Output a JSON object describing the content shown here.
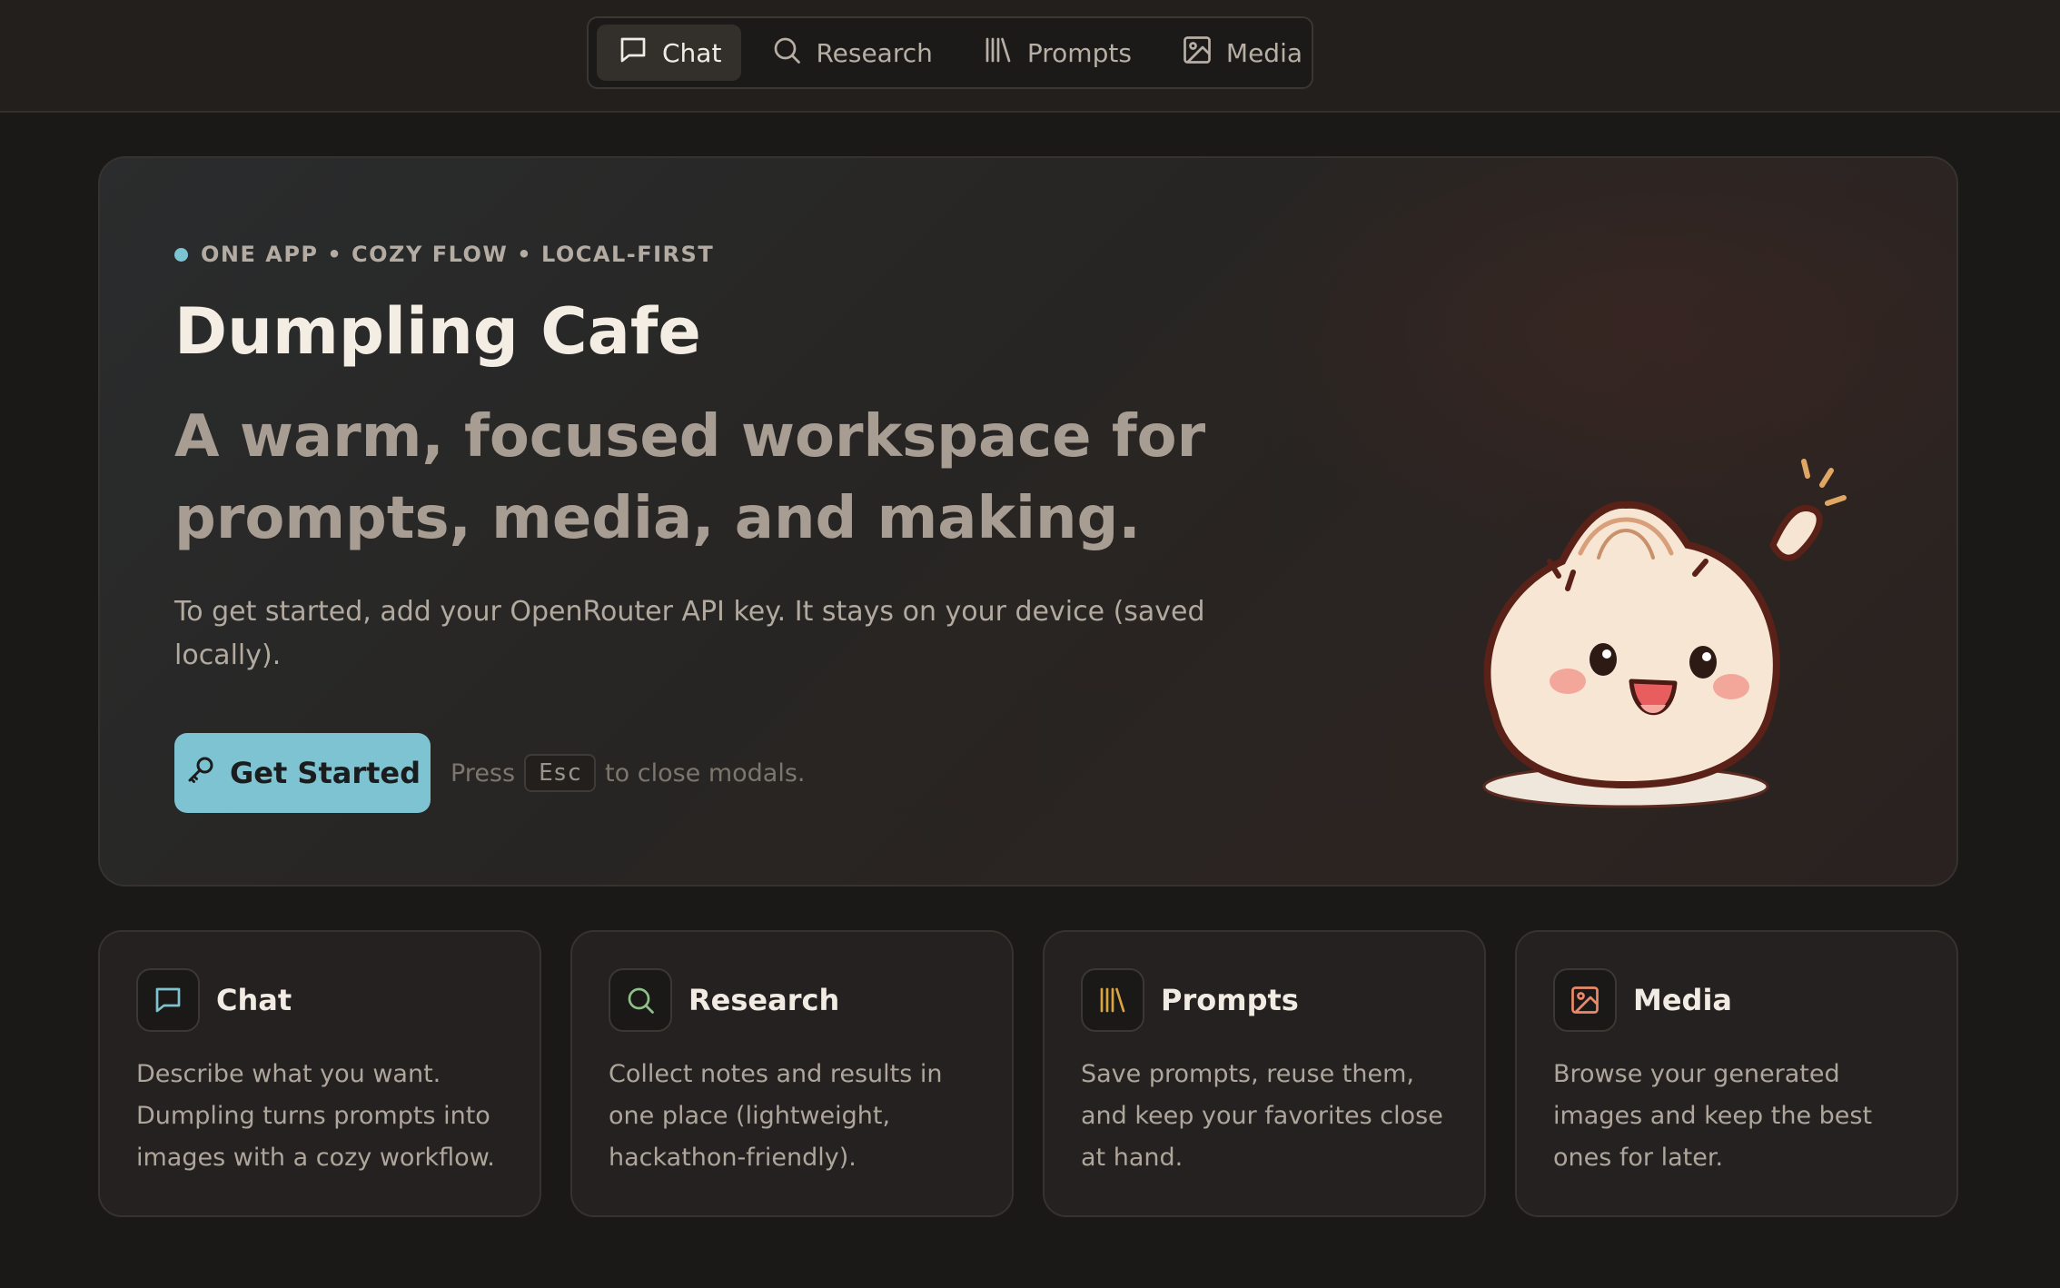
{
  "nav": {
    "items": [
      {
        "label": "Chat",
        "icon": "chat-bubble-icon",
        "active": true
      },
      {
        "label": "Research",
        "icon": "search-icon",
        "active": false
      },
      {
        "label": "Prompts",
        "icon": "library-icon",
        "active": false
      },
      {
        "label": "Media",
        "icon": "image-icon",
        "active": false
      }
    ]
  },
  "hero": {
    "eyebrow": "ONE APP • COZY FLOW • LOCAL-FIRST",
    "title": "Dumpling Cafe",
    "subtitle": "A warm, focused workspace for prompts, media, and making.",
    "description": "To get started, add your OpenRouter API key. It stays on your device (saved locally).",
    "cta_label": "Get Started",
    "cta_icon": "key-icon",
    "hint_prefix": "Press",
    "hint_key": "Esc",
    "hint_suffix": "to close modals.",
    "mascot": "dumpling-mascot"
  },
  "cards": [
    {
      "title": "Chat",
      "icon": "chat-bubble-icon",
      "text": "Describe what you want. Dumpling turns prompts into images with a cozy workflow."
    },
    {
      "title": "Research",
      "icon": "search-icon",
      "text": "Collect notes and results in one place (lightweight, hackathon-friendly)."
    },
    {
      "title": "Prompts",
      "icon": "library-icon",
      "text": "Save prompts, reuse them, and keep your favorites close at hand."
    },
    {
      "title": "Media",
      "icon": "image-icon",
      "text": "Browse your generated images and keep the best ones for later."
    }
  ],
  "colors": {
    "background": "#1b1917",
    "accent": "#7ec3d1",
    "chat_icon": "#7ec3d1",
    "research_icon": "#8fbf8a",
    "prompts_icon": "#d9a441",
    "media_icon": "#e88a6a"
  }
}
